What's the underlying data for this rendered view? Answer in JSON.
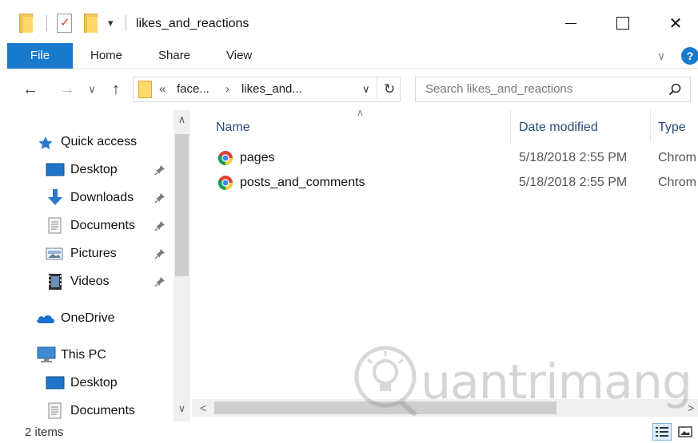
{
  "window": {
    "title": "likes_and_reactions",
    "minimize_label": "",
    "maximize_label": "",
    "close_label": "✕"
  },
  "quick_toolbar": {
    "dropdown_glyph": "▾"
  },
  "ribbon": {
    "tabs": [
      {
        "label": "File"
      },
      {
        "label": "Home"
      },
      {
        "label": "Share"
      },
      {
        "label": "View"
      }
    ],
    "expand_glyph": "∨",
    "help_label": "?"
  },
  "address_bar": {
    "overflow_glyph": "«",
    "crumbs": [
      "face...",
      "likes_and..."
    ],
    "crumb_separator": "›",
    "dropdown_glyph": "∨",
    "refresh_glyph": "↻"
  },
  "nav_buttons": {
    "back": "←",
    "forward": "→",
    "recent": "∨",
    "up": "↑"
  },
  "search": {
    "placeholder": "Search likes_and_reactions"
  },
  "nav_pane": {
    "quick_access": "Quick access",
    "quick_items": [
      {
        "label": "Desktop",
        "icon": "desktop-icon",
        "pinned": true
      },
      {
        "label": "Downloads",
        "icon": "downloads-icon",
        "pinned": true
      },
      {
        "label": "Documents",
        "icon": "documents-icon",
        "pinned": true
      },
      {
        "label": "Pictures",
        "icon": "pictures-icon",
        "pinned": true
      },
      {
        "label": "Videos",
        "icon": "videos-icon",
        "pinned": true
      }
    ],
    "onedrive": "OneDrive",
    "this_pc": "This PC",
    "pc_items": [
      {
        "label": "Desktop",
        "icon": "desktop-icon"
      },
      {
        "label": "Documents",
        "icon": "documents-icon"
      }
    ],
    "scroll_up": "∧",
    "scroll_down": "∨"
  },
  "file_list": {
    "columns": {
      "name": "Name",
      "date_modified": "Date modified",
      "type": "Type"
    },
    "sort_glyph": "∧",
    "rows": [
      {
        "name": "pages",
        "date_modified": "5/18/2018 2:55 PM",
        "type": "Chrom",
        "icon": "chrome-icon"
      },
      {
        "name": "posts_and_comments",
        "date_modified": "5/18/2018 2:55 PM",
        "type": "Chrom",
        "icon": "chrome-icon"
      }
    ],
    "scroll_left": "<",
    "scroll_right": ">"
  },
  "status_bar": {
    "item_count": "2 items"
  },
  "watermark": {
    "text": "uantrimang"
  },
  "colors": {
    "accent": "#1979ca",
    "folder": "#ffd86b",
    "header_text": "#2a4d7f"
  }
}
